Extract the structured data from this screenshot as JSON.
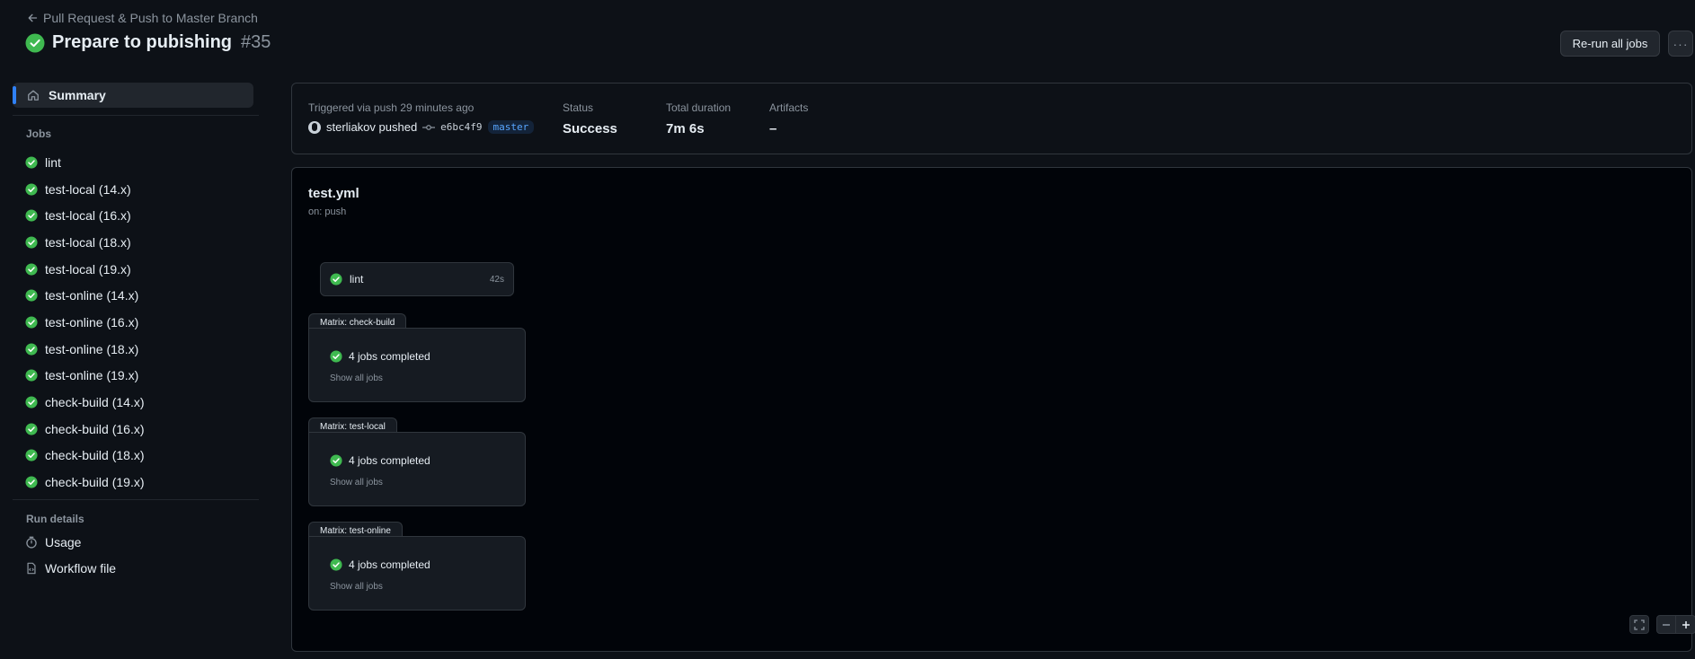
{
  "header": {
    "back_label": "Pull Request & Push to Master Branch",
    "title": "Prepare to pubishing",
    "run_number": "#35",
    "rerun_label": "Re-run all jobs",
    "more_label": "···"
  },
  "sidebar": {
    "summary_label": "Summary",
    "jobs_heading": "Jobs",
    "jobs": [
      {
        "name": "lint",
        "status": "success"
      },
      {
        "name": "test-local (14.x)",
        "status": "success"
      },
      {
        "name": "test-local (16.x)",
        "status": "success"
      },
      {
        "name": "test-local (18.x)",
        "status": "success"
      },
      {
        "name": "test-local (19.x)",
        "status": "success"
      },
      {
        "name": "test-online (14.x)",
        "status": "success"
      },
      {
        "name": "test-online (16.x)",
        "status": "success"
      },
      {
        "name": "test-online (18.x)",
        "status": "success"
      },
      {
        "name": "test-online (19.x)",
        "status": "success"
      },
      {
        "name": "check-build (14.x)",
        "status": "success"
      },
      {
        "name": "check-build (16.x)",
        "status": "success"
      },
      {
        "name": "check-build (18.x)",
        "status": "success"
      },
      {
        "name": "check-build (19.x)",
        "status": "success"
      }
    ],
    "run_details_heading": "Run details",
    "usage_label": "Usage",
    "workflow_file_label": "Workflow file"
  },
  "summary": {
    "trigger_text": "Triggered via push 29 minutes ago",
    "actor_text": "sterliakov pushed",
    "commit_sha": "e6bc4f9",
    "branch": "master",
    "status_label": "Status",
    "status_value": "Success",
    "duration_label": "Total duration",
    "duration_value": "7m 6s",
    "artifacts_label": "Artifacts",
    "artifacts_value": "–"
  },
  "workflow": {
    "file": "test.yml",
    "on": "on: push",
    "lint_job": {
      "name": "lint",
      "duration": "42s"
    },
    "matrices": [
      {
        "label": "Matrix: check-build",
        "status": "4 jobs completed",
        "link": "Show all jobs"
      },
      {
        "label": "Matrix: test-local",
        "status": "4 jobs completed",
        "link": "Show all jobs"
      },
      {
        "label": "Matrix: test-online",
        "status": "4 jobs completed",
        "link": "Show all jobs"
      }
    ]
  },
  "colors": {
    "success": "#3fb950",
    "accent": "#2f81f7",
    "background": "#0d1117"
  }
}
